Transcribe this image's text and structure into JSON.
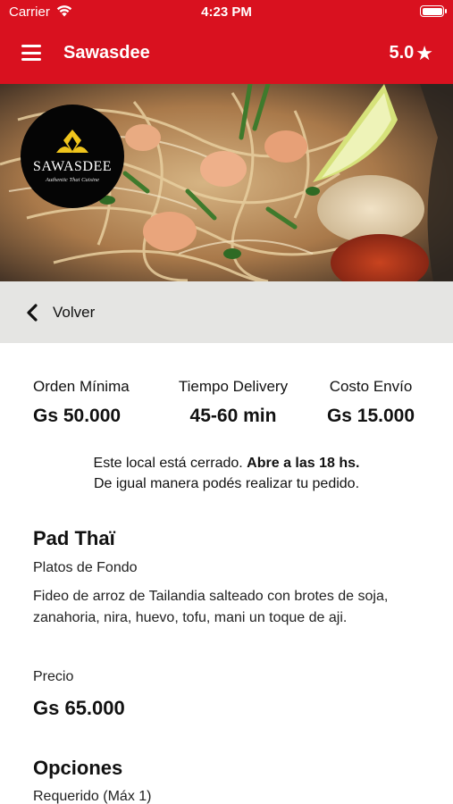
{
  "status_bar": {
    "carrier": "Carrier",
    "time": "4:23 PM"
  },
  "app_bar": {
    "title": "Sawasdee",
    "rating": "5.0",
    "rating_star": "★",
    "color": "#d9111f"
  },
  "logo": {
    "name": "SAWASDEE",
    "tagline": "Authentic Thai Cuisine"
  },
  "back": {
    "label": "Volver"
  },
  "info": {
    "min_order_label": "Orden Mínima",
    "min_order_value": "Gs 50.000",
    "delivery_time_label": "Tiempo Delivery",
    "delivery_time_value": "45-60 min",
    "shipping_cost_label": "Costo Envío",
    "shipping_cost_value": "Gs 15.000"
  },
  "notice": {
    "closed_text": "Este local está cerrado.",
    "opens_text": "Abre a las 18 hs.",
    "order_anyway_text": "De igual manera podés realizar tu pedido."
  },
  "product": {
    "name": "Pad Thaï",
    "category": "Platos de Fondo",
    "description": "Fideo de arroz de Tailandia salteado con brotes de soja, zanahoria, nira, huevo, tofu, mani un toque de aji.",
    "price_label": "Precio",
    "price": "Gs 65.000"
  },
  "options": {
    "title": "Opciones",
    "requirement": "Requerido (Máx 1)"
  },
  "icons": {
    "wifi": "wifi-icon",
    "battery": "battery-icon",
    "menu": "hamburger-menu-icon",
    "star": "star-icon",
    "back": "chevron-left-icon"
  }
}
